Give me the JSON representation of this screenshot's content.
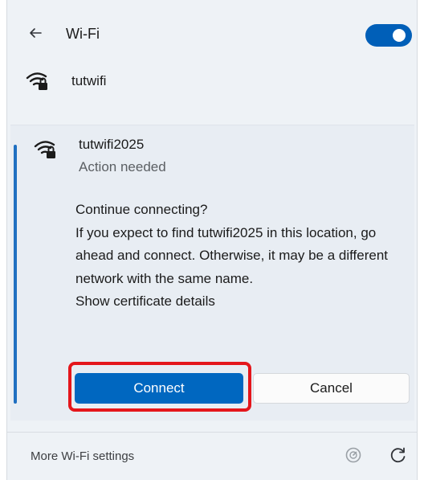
{
  "header": {
    "title": "Wi-Fi",
    "toggle_on": true,
    "accent_color": "#005fb8"
  },
  "networks": [
    {
      "name": "tutwifi",
      "icon": "wifi-secured-icon"
    },
    {
      "name": "tutwifi2025",
      "icon": "wifi-secured-icon",
      "status": "Action needed"
    }
  ],
  "prompt": {
    "lines": [
      "Continue connecting?",
      "If you expect to find tutwifi2025 in this location, go ahead and connect. Otherwise, it may be a different network with the same name.",
      "Show certificate details"
    ]
  },
  "buttons": {
    "connect": "Connect",
    "cancel": "Cancel"
  },
  "footer": {
    "settings_link": "More Wi-Fi settings",
    "icons": [
      "speedometer-icon",
      "refresh-icon"
    ]
  },
  "colors": {
    "primary_button": "#0067c0",
    "highlight_border": "#e4161b"
  }
}
